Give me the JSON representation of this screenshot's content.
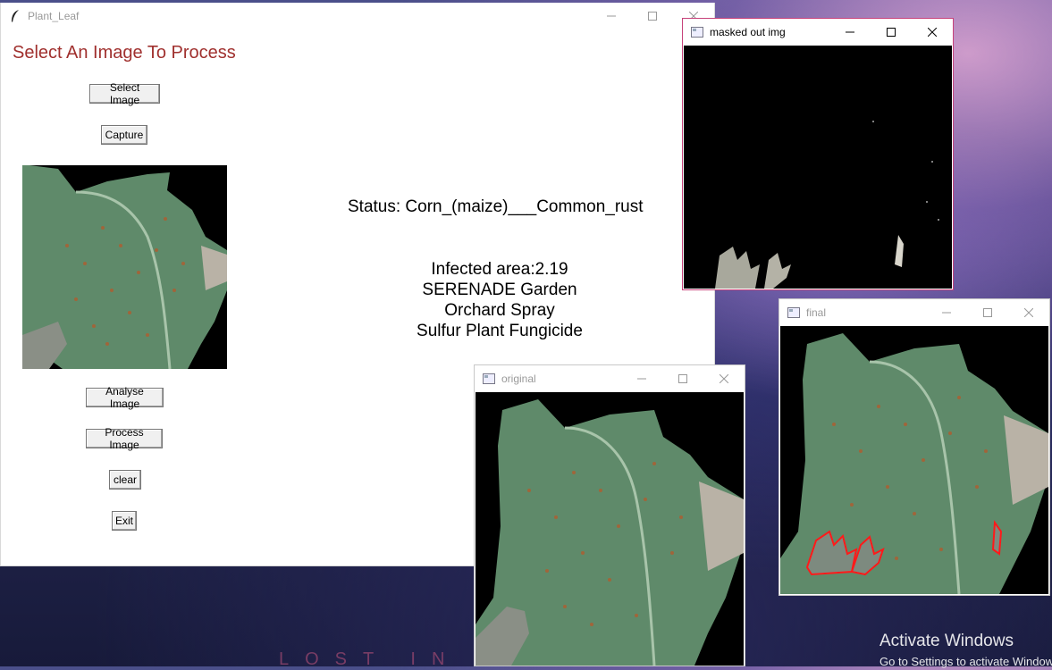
{
  "desktop": {
    "watermark_line1": "Activate Windows",
    "watermark_line2": "Go to Settings to activate Windows.",
    "wallpaper_text": "LOST IN MIND"
  },
  "main_window": {
    "title": "Plant_Leaf",
    "heading": "Select An Image To Process",
    "buttons": {
      "select_image": "Select Image",
      "capture": "Capture",
      "analyse_image": "Analyse Image",
      "process_image": "Process Image",
      "clear": "clear",
      "exit": "Exit"
    },
    "status": "Status: Corn_(maize)___Common_rust",
    "infected_area": "Infected area:2.19",
    "remedies": [
      "SERENADE Garden",
      "Orchard Spray",
      "Sulfur Plant Fungicide"
    ]
  },
  "cv_windows": {
    "masked": {
      "title": "masked out img"
    },
    "original": {
      "title": "original"
    },
    "final": {
      "title": "final"
    }
  },
  "colors": {
    "heading": "#a0302e",
    "active_border": "#c7427a",
    "leaf_green": "#5f8a6a",
    "rust_spot": "#a0653a",
    "contour_red": "#ff1a1a"
  }
}
